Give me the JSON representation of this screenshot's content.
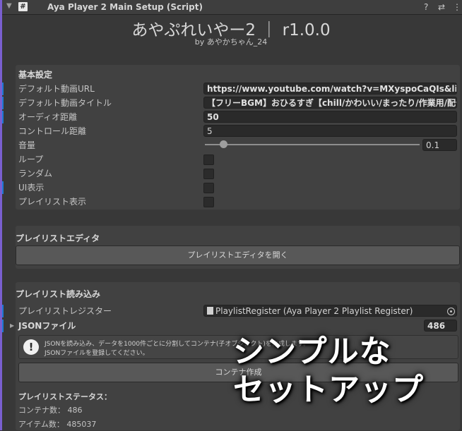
{
  "header": {
    "fold_icon": "triangle-down",
    "script_icon_text": "#",
    "title": "Aya Player 2 Main Setup (Script)",
    "help_icon": "?",
    "preset_icon": "⇄",
    "menu_icon": "⋮"
  },
  "banner": {
    "title": "あやぷれいやー2 ｜ r1.0.0",
    "subtitle": "by あやかちゃん_24"
  },
  "basic": {
    "section_title": "基本設定",
    "rows": {
      "default_url_label": "デフォルト動画URL",
      "default_url_value": "https://www.youtube.com/watch?v=MXyspoCaQIs&list=RDMXyspoCaQIs",
      "default_title_label": "デフォルト動画タイトル",
      "default_title_value": "【フリーBGM】おひるすぎ【chill/かわいい/まったり/作業用/配信用】",
      "audio_distance_label": "オーディオ距離",
      "audio_distance_value": "50",
      "control_distance_label": "コントロール距離",
      "control_distance_value": "5",
      "volume_label": "音量",
      "volume_value": "0.1",
      "loop_label": "ループ",
      "random_label": "ランダム",
      "ui_display_label": "UI表示",
      "playlist_display_label": "プレイリスト表示"
    },
    "volume_fraction": 0.1,
    "checkboxes": {
      "loop": false,
      "random": false,
      "ui_display": false,
      "playlist_display": false
    }
  },
  "playlist_editor": {
    "section_title": "プレイリストエディタ",
    "open_button": "プレイリストエディタを開く"
  },
  "playlist_import": {
    "section_title": "プレイリスト読み込み",
    "register_label": "プレイリストレジスター",
    "register_value": "PlaylistRegister (Aya Player 2 Playlist Register)",
    "json_label": "JSONファイル",
    "json_count": "486",
    "help_icon": "!",
    "help_line1": "JSONを読み込み、データを1000件ごとに分割してコンテナ(子オブジェクト)を作成します。",
    "help_line2": "JSONファイルを登録してください。",
    "create_button": "コンテナ作成"
  },
  "status": {
    "title": "プレイリストステータス：",
    "containers": "コンテナ数： 486",
    "items": "アイテム数： 485037"
  },
  "overlay": {
    "line1": "シンプルな",
    "line2": "セットアップ"
  }
}
